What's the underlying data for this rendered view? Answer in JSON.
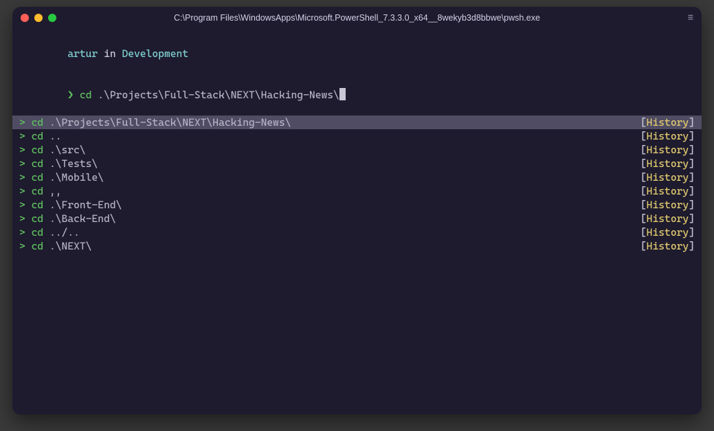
{
  "window": {
    "title": "C:\\Program Files\\WindowsApps\\Microsoft.PowerShell_7.3.3.0_x64__8wekyb3d8bbwe\\pwsh.exe"
  },
  "prompt": {
    "user": "artur",
    "in": "in",
    "location": "Development",
    "arrow": "❯",
    "list_arrow": ">",
    "command": "cd",
    "input_args": ".\\Projects\\Full-Stack\\NEXT\\Hacking-News\\"
  },
  "history_tag": {
    "open": "[",
    "label": "History",
    "close": "]"
  },
  "suggestions": [
    {
      "args": ".\\Projects\\Full-Stack\\NEXT\\Hacking-News\\",
      "selected": true
    },
    {
      "args": "..",
      "selected": false
    },
    {
      "args": ".\\src\\",
      "selected": false
    },
    {
      "args": ".\\Tests\\",
      "selected": false
    },
    {
      "args": ".\\Mobile\\",
      "selected": false
    },
    {
      "args": ",,",
      "selected": false
    },
    {
      "args": ".\\Front-End\\",
      "selected": false
    },
    {
      "args": ".\\Back-End\\",
      "selected": false
    },
    {
      "args": "../..",
      "selected": false
    },
    {
      "args": ".\\NEXT\\",
      "selected": false
    }
  ]
}
